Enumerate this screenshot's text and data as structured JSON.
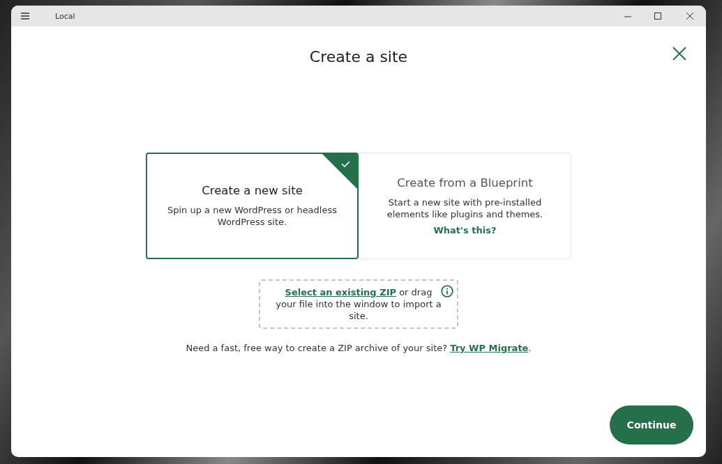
{
  "window": {
    "title": "Local"
  },
  "dialog": {
    "title": "Create a site"
  },
  "options": [
    {
      "title": "Create a new site",
      "description": "Spin up a new WordPress or headless WordPress site.",
      "selected": true
    },
    {
      "title": "Create from a Blueprint",
      "description": "Start a new site with pre-installed elements like plugins and themes.",
      "link": "What's this?",
      "selected": false
    }
  ],
  "import_zone": {
    "link": "Select an existing ZIP",
    "text": " or drag your file into the window to import a site."
  },
  "migrate_prompt": {
    "text": "Need a fast, free way to create a ZIP archive of your site? ",
    "link": "Try WP Migrate",
    "suffix": "."
  },
  "continue_button": "Continue"
}
